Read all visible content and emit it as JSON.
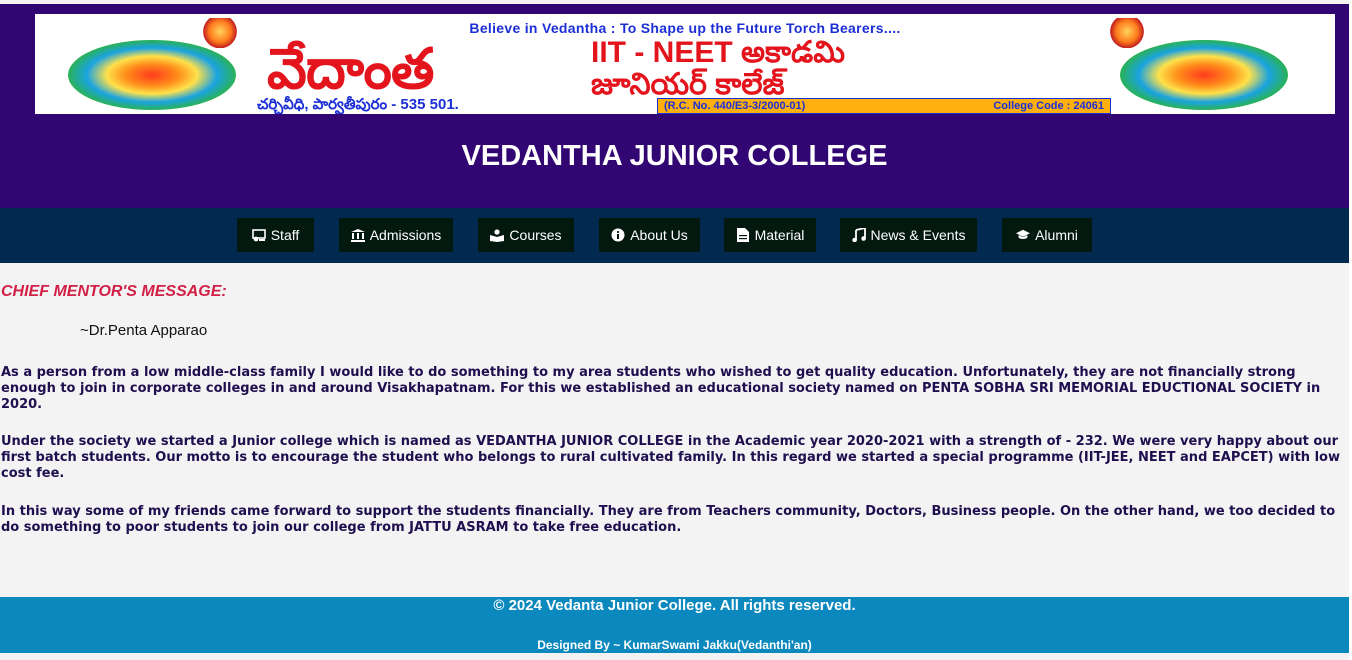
{
  "banner": {
    "tagline": "Believe in Vedantha :  To Shape up the Future Torch Bearers....",
    "name_telugu": "వేదాంత",
    "line1": "IIT - NEET అకాడమి",
    "line2": "జూనియర్ కాలేజ్",
    "address": "చర్చివీధి, పార్వతీపురం - 535 501.",
    "reg_no": "(R.C. No. 440/E3-3/2000-01)",
    "college_code": "College Code : 24061"
  },
  "site_title": "VEDANTHA JUNIOR COLLEGE",
  "nav": [
    {
      "label": "Staff",
      "icon": "staff-icon"
    },
    {
      "label": "Admissions",
      "icon": "institution-icon"
    },
    {
      "label": "Courses",
      "icon": "book-reader-icon"
    },
    {
      "label": "About Us",
      "icon": "info-circle-icon"
    },
    {
      "label": "Material",
      "icon": "file-icon"
    },
    {
      "label": "News & Events",
      "icon": "music-note-icon"
    },
    {
      "label": "Alumni",
      "icon": "graduation-cap-icon"
    }
  ],
  "content": {
    "heading": "CHIEF MENTOR'S MESSAGE:",
    "mentor": "~Dr.Penta Apparao",
    "paragraphs": [
      "As a person from a low middle-class family I would like to do something to my area students who wished to get quality education. Unfortunately, they are not financially strong enough to join in corporate colleges in and around Visakhapatnam. For this we established an educational society named on PENTA SOBHA SRI MEMORIAL EDUCTIONAL SOCIETY in 2020.",
      "Under the society we started a Junior college which is named as VEDANTHA JUNIOR COLLEGE in the Academic year 2020-2021 with a strength of - 232. We were very happy about our first batch students. Our motto is to encourage the student who belongs to rural cultivated family. In this regard we started a special programme (IIT-JEE, NEET and EAPCET) with low cost fee.",
      "In this way some of my friends came forward to support the students financially. They are from Teachers community, Doctors, Business people. On the other hand, we too decided to do something to poor students to join our college from JATTU ASRAM to take free education."
    ]
  },
  "footer": {
    "copyright": "© 2024 Vedanta Junior College. All rights reserved.",
    "designer": "Designed By ~ KumarSwami Jakku(Vedanthi'an)"
  },
  "colors": {
    "header_bg": "#320672",
    "nav_bg": "#022a50",
    "nav_button_bg": "#03190f",
    "heading_red": "#d21f46",
    "body_text": "#1f0f4e",
    "footer_bg": "#0b88bd"
  }
}
